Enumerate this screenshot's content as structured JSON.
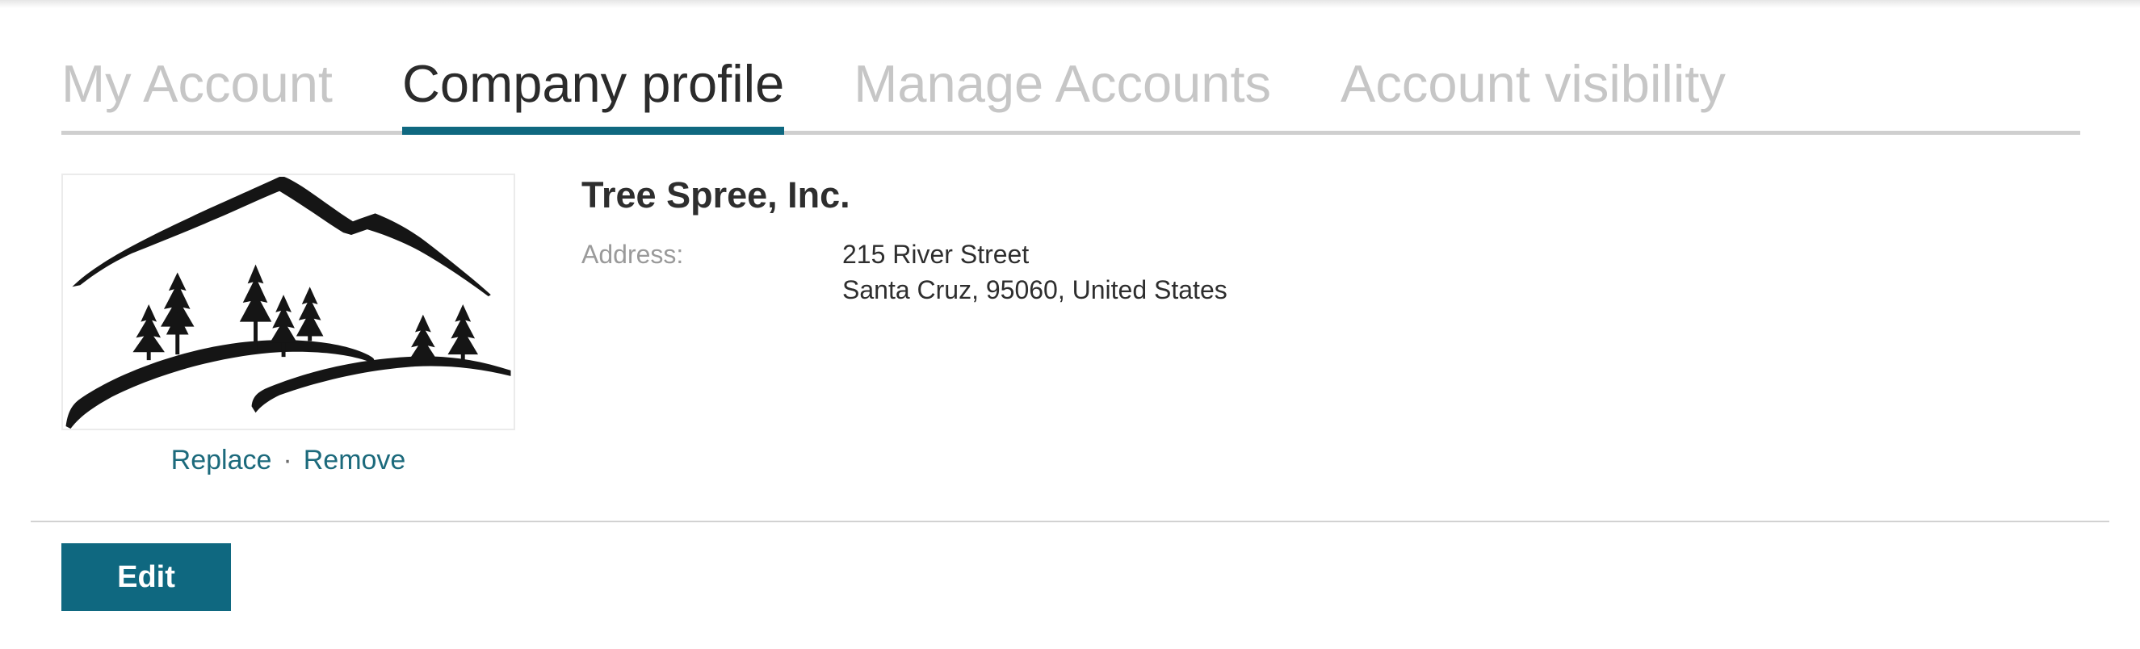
{
  "tabs": [
    {
      "label": "My Account",
      "active": false
    },
    {
      "label": "Company profile",
      "active": true
    },
    {
      "label": "Manage Accounts",
      "active": false
    },
    {
      "label": "Account visibility",
      "active": false
    }
  ],
  "logo": {
    "icon": "tree-mountain-logo",
    "replace_label": "Replace",
    "separator": "·",
    "remove_label": "Remove"
  },
  "company": {
    "name": "Tree Spree, Inc.",
    "address_label": "Address:",
    "address_line1": "215 River Street",
    "address_line2": "Santa Cruz, 95060, United States"
  },
  "actions": {
    "edit_label": "Edit"
  },
  "colors": {
    "accent": "#0f6880",
    "link": "#1c6a7c",
    "tab_inactive": "#c6c6c6",
    "text": "#2e2e2e"
  }
}
